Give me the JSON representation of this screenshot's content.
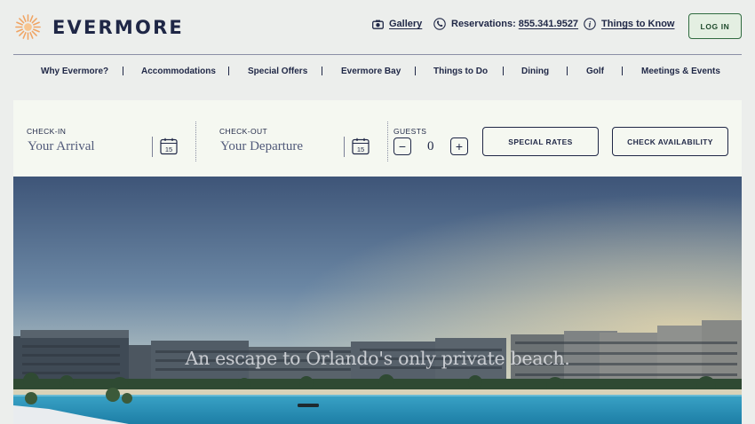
{
  "brand": {
    "name": "EVERMORE"
  },
  "utility": {
    "gallery": "Gallery",
    "reservations_label": "Reservations:",
    "reservations_phone": "855.341.9527",
    "things_to_know": "Things to Know",
    "login": "LOG IN"
  },
  "nav": {
    "items": [
      "Why Evermore?",
      "Accommodations",
      "Special Offers",
      "Evermore Bay",
      "Things to Do",
      "Dining",
      "Golf",
      "Meetings & Events"
    ]
  },
  "booking": {
    "checkin_label": "CHECK-IN",
    "checkin_placeholder": "Your Arrival",
    "checkout_label": "CHECK-OUT",
    "checkout_placeholder": "Your Departure",
    "calendar_day": "15",
    "guests_label": "GUESTS",
    "guests_count": "0",
    "decrement": "−",
    "increment": "+",
    "special_rates": "SPECIAL RATES",
    "check_availability": "CHECK AVAILABILITY"
  },
  "hero": {
    "tagline": "An escape to Orlando's only private beach."
  },
  "colors": {
    "navy": "#1f2746",
    "green_accent": "#2f6b3f",
    "logo_orange": "#f0a463"
  }
}
